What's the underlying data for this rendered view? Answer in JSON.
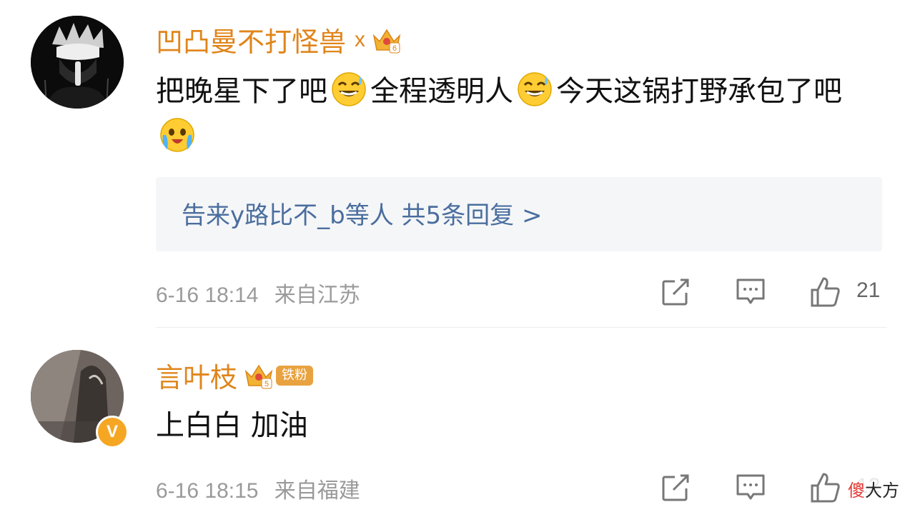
{
  "comments": [
    {
      "username": "凹凸曼不打怪兽",
      "name_suffix": "x",
      "level_badge": "6",
      "text_parts": [
        "把晚星下了吧",
        "全程透明人",
        "今天这锅打野承包了吧"
      ],
      "emoji_names": [
        "sweat-smile-emoji",
        "sweat-smile-emoji",
        "crying-happy-emoji"
      ],
      "reply_summary": "告来y路比不_b等人  共5条回复 >",
      "time": "6-16 18:14",
      "location": "来自江苏",
      "like_count": "21"
    },
    {
      "username": "言叶枝",
      "level_badge": "5",
      "fan_badge": "铁粉",
      "verified_badge": "V",
      "text": "上白白 加油",
      "time": "6-16 18:15",
      "location": "来自福建",
      "like_count": "12"
    }
  ],
  "watermark": {
    "red": "傻",
    "rest": "大方"
  },
  "colors": {
    "username": "#e0851b",
    "link": "#4a6e9e",
    "meta": "#9a9a9a"
  }
}
